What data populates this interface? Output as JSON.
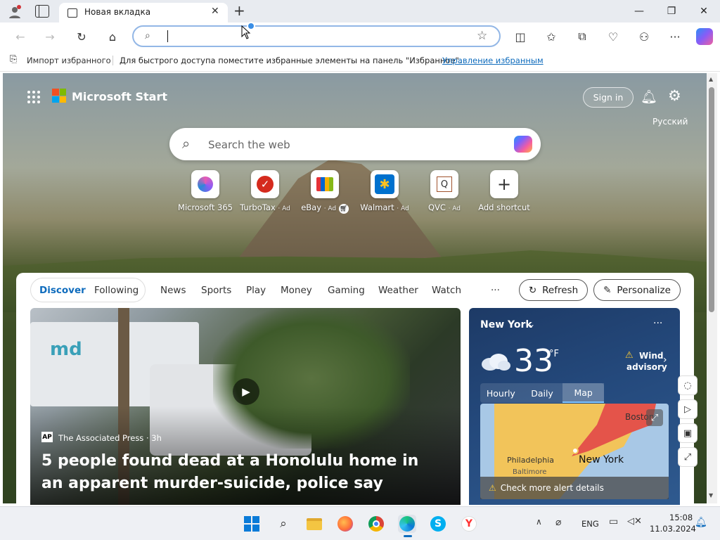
{
  "browser": {
    "tab_title": "Новая вкладка",
    "address_value": "",
    "favorites_bar": {
      "import_label": "Импорт избранного",
      "hint": "Для быстрого доступа поместите избранные элементы на панель \"Избранное\".",
      "manage_link": "Управление избранным"
    }
  },
  "start": {
    "brand": "Microsoft Start",
    "sign_in": "Sign in",
    "language": "Русский",
    "search_placeholder": "Search the web",
    "shortcuts": [
      {
        "label": "Microsoft 365",
        "ad": "",
        "icon": "microsoft-365-icon"
      },
      {
        "label": "TurboTax",
        "ad": "· Ad",
        "icon": "turbotax-icon"
      },
      {
        "label": "eBay",
        "ad": "· Ad",
        "icon": "ebay-icon"
      },
      {
        "label": "Walmart",
        "ad": "· Ad",
        "icon": "walmart-icon"
      },
      {
        "label": "QVC",
        "ad": "· Ad",
        "icon": "qvc-icon"
      },
      {
        "label": "Add shortcut",
        "ad": "",
        "icon": "plus-icon"
      }
    ],
    "nav": {
      "discover": "Discover",
      "following": "Following",
      "items": [
        "News",
        "Sports",
        "Play",
        "Money",
        "Gaming",
        "Weather",
        "Watch"
      ],
      "more": "···",
      "refresh": "Refresh",
      "personalize": "Personalize"
    },
    "hero": {
      "source": "The Associated Press · 3h",
      "title": "5 people found dead at a Honolulu home in an apparent murder-suicide, police say"
    },
    "weather": {
      "location": "New York",
      "temperature": "33",
      "unit": "°F",
      "alert_title": "Wind",
      "alert_sub": "advisory",
      "tabs": [
        "Hourly",
        "Daily",
        "Map"
      ],
      "active_tab": "Map",
      "map_labels": {
        "city1": "Boston",
        "city2": "Philadelphia",
        "city3": "Baltimore",
        "city4": "New York"
      },
      "alert_details": "Check more alert details"
    }
  },
  "taskbar": {
    "language": "ENG",
    "time": "15:08",
    "date": "11.03.2024"
  },
  "colors": {
    "accent": "#0f6cbd",
    "titlebar": "#e8ebf0",
    "weather_bg": "#24497c"
  }
}
